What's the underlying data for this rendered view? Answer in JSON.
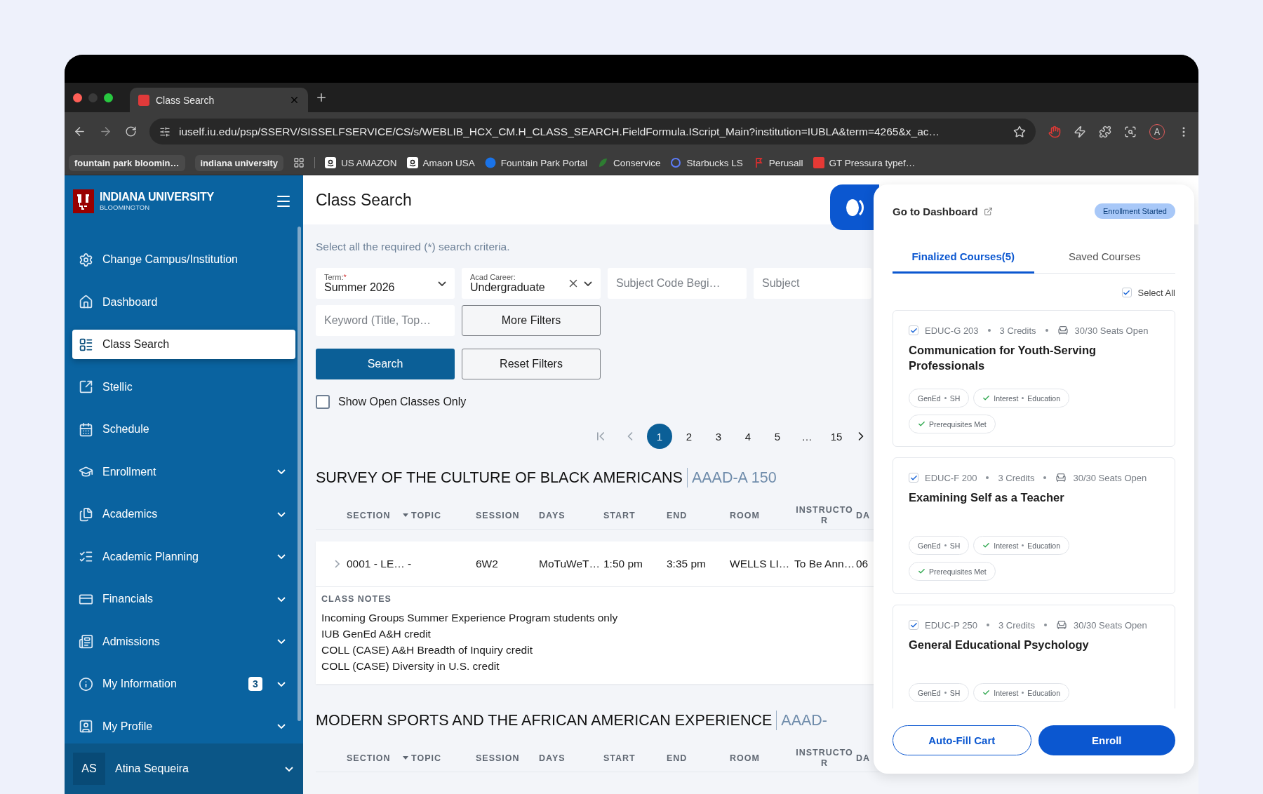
{
  "browser": {
    "tab_title": "Class Search",
    "url": "iuself.iu.edu/psp/SSERV/SISSELFSERVICE/CS/s/WEBLIB_HCX_CM.H_CLASS_SEARCH.FieldFormula.IScript_Main?institution=IUBLA&term=4265&x_ac…",
    "profile_initial": "A",
    "bookmarks": [
      {
        "kind": "group",
        "label": "fountain park bloomin…"
      },
      {
        "kind": "group",
        "label": "indiana university"
      },
      {
        "kind": "link",
        "label": "US AMAZON"
      },
      {
        "kind": "link",
        "label": "Amaon USA"
      },
      {
        "kind": "link",
        "label": "Fountain Park Portal"
      },
      {
        "kind": "link",
        "label": "Conservice"
      },
      {
        "kind": "link",
        "label": "Starbucks LS"
      },
      {
        "kind": "link",
        "label": "Perusall"
      },
      {
        "kind": "link",
        "label": "GT Pressura typef…"
      }
    ]
  },
  "sidebar": {
    "brand": "INDIANA UNIVERSITY",
    "campus": "BLOOMINGTON",
    "items": [
      {
        "label": "Change Campus/Institution",
        "selected": false,
        "expandable": false
      },
      {
        "label": "Dashboard",
        "selected": false,
        "expandable": false
      },
      {
        "label": "Class Search",
        "selected": true,
        "expandable": false
      },
      {
        "label": "Stellic",
        "selected": false,
        "expandable": false
      },
      {
        "label": "Schedule",
        "selected": false,
        "expandable": false
      },
      {
        "label": "Enrollment",
        "selected": false,
        "expandable": true
      },
      {
        "label": "Academics",
        "selected": false,
        "expandable": true
      },
      {
        "label": "Academic Planning",
        "selected": false,
        "expandable": true
      },
      {
        "label": "Financials",
        "selected": false,
        "expandable": true
      },
      {
        "label": "Admissions",
        "selected": false,
        "expandable": true
      },
      {
        "label": "My Information",
        "selected": false,
        "expandable": true,
        "badge": "3"
      },
      {
        "label": "My Profile",
        "selected": false,
        "expandable": true
      }
    ],
    "user": {
      "initials": "AS",
      "name": "Atina Sequeira"
    }
  },
  "main": {
    "title": "Class Search",
    "hint": "Select all the required (*) search criteria.",
    "filters": [
      {
        "kind": "select",
        "label": "Term:",
        "required_mark": "*",
        "value": "Summer 2026",
        "clearable": false
      },
      {
        "kind": "select",
        "label": "Acad Career:",
        "value": "Undergraduate",
        "clearable": true
      },
      {
        "kind": "input",
        "placeholder": "Subject Code Begi…"
      },
      {
        "kind": "input",
        "placeholder": "Subject"
      },
      {
        "kind": "input",
        "placeholder": "Keyword (Title, Top…"
      },
      {
        "kind": "button",
        "label": "More Filters"
      }
    ],
    "actions": [
      {
        "kind": "primary",
        "label": "Search"
      },
      {
        "kind": "secondary",
        "label": "Reset Filters"
      }
    ],
    "open_only": {
      "label": "Show Open Classes Only",
      "checked": false
    },
    "pages": [
      {
        "label": "1",
        "selected": true
      },
      {
        "label": "2",
        "selected": false
      },
      {
        "label": "3",
        "selected": false
      },
      {
        "label": "4",
        "selected": false
      },
      {
        "label": "5",
        "selected": false
      },
      {
        "label": "…",
        "selected": false
      },
      {
        "label": "15",
        "selected": false
      }
    ],
    "sections": [
      {
        "title": "SURVEY OF THE CULTURE OF BLACK AMERICANS",
        "code": "AAAD-A 150",
        "columns": [
          "SECTION",
          "TOPIC",
          "SESSION",
          "DAYS",
          "START",
          "END",
          "ROOM",
          "INSTRUCTOR",
          "DA"
        ],
        "rows": [
          {
            "expanded": false,
            "cells": [
              "0001 - LE… -",
              "",
              "6W2",
              "MoTuWeT…",
              "1:50 pm",
              "3:35 pm",
              "WELLS LI…",
              "To Be Ann…",
              "06"
            ],
            "notes": {
              "heading": "CLASS NOTES",
              "lines": [
                "Incoming Groups Summer Experience Program students only",
                "IUB GenEd A&H credit",
                "COLL (CASE) A&H Breadth of Inquiry credit",
                "COLL (CASE) Diversity in U.S. credit"
              ]
            }
          }
        ]
      },
      {
        "title": "MODERN SPORTS AND THE AFRICAN AMERICAN EXPERIENCE",
        "code": "AAAD-",
        "columns": [
          "SECTION",
          "TOPIC",
          "SESSION",
          "DAYS",
          "START",
          "END",
          "ROOM",
          "INSTRUCTOR",
          "DA"
        ]
      }
    ]
  },
  "panel": {
    "dashboard_link": "Go to Dashboard",
    "status": "Enrollment Started",
    "tabs": [
      {
        "label": "Finalized Courses(5)",
        "selected": true
      },
      {
        "label": "Saved Courses",
        "selected": false
      }
    ],
    "select_all": {
      "label": "Select All",
      "checked": true
    },
    "courses": [
      {
        "checked": true,
        "code": "EDUC-G 203",
        "credits": "3 Credits",
        "seats": "30/30 Seats Open",
        "title": "Communication for Youth-Serving Professionals",
        "tags": [
          {
            "label": "GenEd",
            "detail": "SH",
            "met": false
          },
          {
            "label": "Interest",
            "detail": "Education",
            "met": true
          },
          {
            "label": "Prerequisites Met",
            "met": true
          }
        ]
      },
      {
        "checked": true,
        "code": "EDUC-F 200",
        "credits": "3 Credits",
        "seats": "30/30 Seats Open",
        "title": "Examining Self as a Teacher",
        "tags": [
          {
            "label": "GenEd",
            "detail": "SH",
            "met": false
          },
          {
            "label": "Interest",
            "detail": "Education",
            "met": true
          },
          {
            "label": "Prerequisites Met",
            "met": true
          }
        ]
      },
      {
        "checked": true,
        "code": "EDUC-P 250",
        "credits": "3 Credits",
        "seats": "30/30 Seats Open",
        "title": "General Educational Psychology",
        "tags": [
          {
            "label": "GenEd",
            "detail": "SH",
            "met": false
          },
          {
            "label": "Interest",
            "detail": "Education",
            "met": true
          }
        ]
      }
    ],
    "buttons": [
      {
        "kind": "secondary",
        "label": "Auto-Fill Cart"
      },
      {
        "kind": "primary",
        "label": "Enroll"
      }
    ]
  }
}
